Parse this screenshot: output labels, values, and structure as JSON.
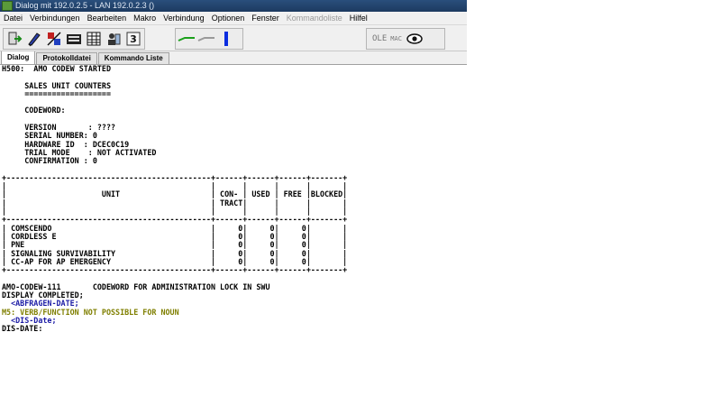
{
  "window": {
    "title": "Dialog mit 192.0.2.5 - LAN 192.0.2.3 ()"
  },
  "menu": [
    {
      "label": "Datei",
      "enabled": true
    },
    {
      "label": "Verbindungen",
      "enabled": true
    },
    {
      "label": "Bearbeiten",
      "enabled": true
    },
    {
      "label": "Makro",
      "enabled": true
    },
    {
      "label": "Verbindung",
      "enabled": true
    },
    {
      "label": "Optionen",
      "enabled": true
    },
    {
      "label": "Fenster",
      "enabled": true
    },
    {
      "label": "Kommandoliste",
      "enabled": false
    },
    {
      "label": "Hilfel",
      "enabled": true
    }
  ],
  "toolbar": {
    "icons": [
      "connect-icon",
      "edit-icon",
      "script-icon",
      "keyboard-icon",
      "grid-icon",
      "users-icon",
      "text-icon"
    ],
    "connection_icons": [
      "connected-arrow-icon",
      "disconnected-arrow-icon",
      "status-bar-icon"
    ],
    "ole_label": "OLE",
    "mac_label": "MAC",
    "view_icon": "eye-icon"
  },
  "tabs": [
    {
      "label": "Dialog",
      "active": true
    },
    {
      "label": "Protokolldatei",
      "active": false
    },
    {
      "label": "Kommando Liste",
      "active": false
    }
  ],
  "terminal": {
    "lines": [
      {
        "text": "H500:  AMO CODEW STARTED",
        "color": "black"
      },
      {
        "text": "",
        "color": "black"
      },
      {
        "text": "     SALES UNIT COUNTERS",
        "color": "black"
      },
      {
        "text": "     ===================",
        "color": "black"
      },
      {
        "text": "",
        "color": "black"
      },
      {
        "text": "     CODEWORD:",
        "color": "black"
      },
      {
        "text": "",
        "color": "black"
      },
      {
        "text": "     VERSION       : ????",
        "color": "black"
      },
      {
        "text": "     SERIAL NUMBER: 0",
        "color": "black"
      },
      {
        "text": "     HARDWARE ID  : DCEC0C19",
        "color": "black"
      },
      {
        "text": "     TRIAL MODE    : NOT ACTIVATED",
        "color": "black"
      },
      {
        "text": "     CONFIRMATION : 0",
        "color": "black"
      },
      {
        "text": "",
        "color": "black"
      },
      {
        "text": "+---------------------------------------------+------+------+------+-------+",
        "color": "black"
      },
      {
        "text": "|                                             |      |      |      |       |",
        "color": "black"
      },
      {
        "text": "|                     UNIT                    | CON- | USED | FREE |BLOCKED|",
        "color": "black"
      },
      {
        "text": "|                                             | TRACT|      |      |       |",
        "color": "black"
      },
      {
        "text": "|                                             |      |      |      |       |",
        "color": "black"
      },
      {
        "text": "+---------------------------------------------+------+------+------+-------+",
        "color": "black"
      },
      {
        "text": "| COMSCENDO                                   |     0|     0|     0|       |",
        "color": "black"
      },
      {
        "text": "| CORDLESS E                                  |     0|     0|     0|       |",
        "color": "black"
      },
      {
        "text": "| PNE                                         |     0|     0|     0|       |",
        "color": "black"
      },
      {
        "text": "| SIGNALING SURVIVABILITY                     |     0|     0|     0|       |",
        "color": "black"
      },
      {
        "text": "| CC-AP FOR AP EMERGENCY                      |     0|     0|     0|       |",
        "color": "black"
      },
      {
        "text": "+---------------------------------------------+------+------+------+-------+",
        "color": "black"
      },
      {
        "text": "",
        "color": "black"
      },
      {
        "text": "AMO-CODEW-111       CODEWORD FOR ADMINISTRATION LOCK IN SWU",
        "color": "black"
      },
      {
        "text": "DISPLAY COMPLETED;",
        "color": "black"
      },
      {
        "text": "  <ABFRAGEN-DATE;",
        "color": "blue"
      },
      {
        "text": "M5: VERB/FUNCTION NOT POSSIBLE FOR NOUN",
        "color": "olive"
      },
      {
        "text": "  <DIS-Date;",
        "color": "blue"
      },
      {
        "text": "DIS-DATE:",
        "color": "black"
      }
    ]
  }
}
